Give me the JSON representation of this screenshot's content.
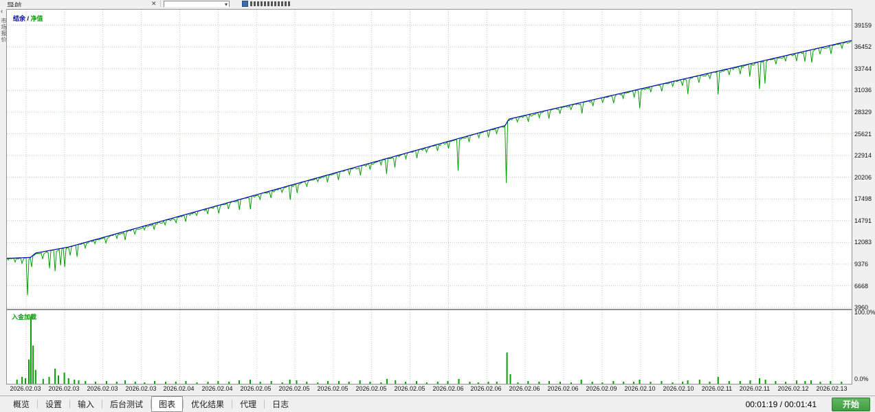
{
  "navigator": {
    "title": "导航",
    "vertical_tab": "市场报价"
  },
  "icons": {
    "close": "✕",
    "collapse": "‹",
    "combo_arrow": "▾"
  },
  "status": {
    "elapsed": "00:01:19 / 00:01:41",
    "start_label": "开始"
  },
  "tabs": {
    "items": [
      {
        "label": "概览"
      },
      {
        "label": "设置"
      },
      {
        "label": "输入"
      },
      {
        "label": "后台测试"
      },
      {
        "label": "图表",
        "active": true
      },
      {
        "label": "优化结果"
      },
      {
        "label": "代理"
      },
      {
        "label": "日志"
      }
    ]
  },
  "chart_data": [
    {
      "type": "line",
      "title": "结余 / 净值",
      "ylim": [
        3800,
        41100
      ],
      "yticks": [
        39159,
        36452,
        33744,
        31036,
        28329,
        25621,
        22914,
        20206,
        17498,
        14791,
        12083,
        9376,
        6668,
        3960
      ],
      "x_labels": [
        "2026.02.03",
        "2026.02.03",
        "2026.02.03",
        "2026.02.03",
        "2026.02.04",
        "2026.02.04",
        "2026.02.05",
        "2026.02.05",
        "2026.02.05",
        "2026.02.05",
        "2026.02.05",
        "2026.02.06",
        "2026.02.06",
        "2026.02.06",
        "2026.02.06",
        "2026.02.09",
        "2026.02.10",
        "2026.02.10",
        "2026.02.11",
        "2026.02.11",
        "2026.02.12",
        "2026.02.13"
      ],
      "series": [
        {
          "name": "结余",
          "color": "#0000B4",
          "role": "balance"
        },
        {
          "name": "净值",
          "color": "#00A000",
          "role": "equity"
        }
      ],
      "balance_anchors": [
        [
          0,
          10100
        ],
        [
          0.028,
          10200
        ],
        [
          0.034,
          10750
        ],
        [
          0.073,
          11500
        ],
        [
          0.59,
          26650
        ],
        [
          0.594,
          27450
        ],
        [
          1,
          37250
        ]
      ],
      "equity_dips": [
        [
          0.01,
          500
        ],
        [
          0.018,
          700
        ],
        [
          0.024,
          4700
        ],
        [
          0.03,
          1300
        ],
        [
          0.043,
          900
        ],
        [
          0.05,
          2200
        ],
        [
          0.057,
          2700
        ],
        [
          0.064,
          2100
        ],
        [
          0.068,
          2400
        ],
        [
          0.075,
          1100
        ],
        [
          0.083,
          1500
        ],
        [
          0.093,
          700
        ],
        [
          0.105,
          500
        ],
        [
          0.118,
          800
        ],
        [
          0.13,
          600
        ],
        [
          0.14,
          1100
        ],
        [
          0.152,
          700
        ],
        [
          0.163,
          500
        ],
        [
          0.175,
          800
        ],
        [
          0.188,
          600
        ],
        [
          0.2,
          700
        ],
        [
          0.212,
          900
        ],
        [
          0.225,
          500
        ],
        [
          0.238,
          700
        ],
        [
          0.25,
          1000
        ],
        [
          0.263,
          800
        ],
        [
          0.275,
          1300
        ],
        [
          0.288,
          1600
        ],
        [
          0.3,
          700
        ],
        [
          0.313,
          900
        ],
        [
          0.326,
          600
        ],
        [
          0.335,
          1800
        ],
        [
          0.343,
          1200
        ],
        [
          0.355,
          700
        ],
        [
          0.368,
          500
        ],
        [
          0.38,
          900
        ],
        [
          0.393,
          1000
        ],
        [
          0.405,
          700
        ],
        [
          0.418,
          1200
        ],
        [
          0.43,
          800
        ],
        [
          0.443,
          600
        ],
        [
          0.45,
          1900
        ],
        [
          0.46,
          1400
        ],
        [
          0.472,
          700
        ],
        [
          0.485,
          1000
        ],
        [
          0.497,
          600
        ],
        [
          0.51,
          800
        ],
        [
          0.522,
          900
        ],
        [
          0.535,
          4000
        ],
        [
          0.548,
          800
        ],
        [
          0.558,
          600
        ],
        [
          0.57,
          900
        ],
        [
          0.58,
          700
        ],
        [
          0.592,
          7400
        ],
        [
          0.605,
          600
        ],
        [
          0.617,
          900
        ],
        [
          0.63,
          700
        ],
        [
          0.642,
          1100
        ],
        [
          0.655,
          800
        ],
        [
          0.668,
          600
        ],
        [
          0.68,
          1400
        ],
        [
          0.693,
          800
        ],
        [
          0.705,
          600
        ],
        [
          0.718,
          1000
        ],
        [
          0.73,
          700
        ],
        [
          0.742,
          900
        ],
        [
          0.749,
          2400
        ],
        [
          0.762,
          700
        ],
        [
          0.775,
          900
        ],
        [
          0.788,
          600
        ],
        [
          0.8,
          800
        ],
        [
          0.806,
          2000
        ],
        [
          0.82,
          900
        ],
        [
          0.832,
          700
        ],
        [
          0.842,
          2900
        ],
        [
          0.855,
          800
        ],
        [
          0.868,
          1000
        ],
        [
          0.88,
          1600
        ],
        [
          0.891,
          3400
        ],
        [
          0.898,
          2900
        ],
        [
          0.91,
          800
        ],
        [
          0.922,
          700
        ],
        [
          0.935,
          1000
        ],
        [
          0.945,
          1300
        ],
        [
          0.952,
          1600
        ],
        [
          0.963,
          800
        ],
        [
          0.975,
          1100
        ],
        [
          0.988,
          700
        ]
      ]
    },
    {
      "type": "bar",
      "title": "入金加载",
      "ylim": [
        0,
        100
      ],
      "ytick_labels": [
        "100.0%",
        "0.0%"
      ],
      "color": "#00A000",
      "bars": [
        [
          0.012,
          6
        ],
        [
          0.018,
          10
        ],
        [
          0.022,
          8
        ],
        [
          0.026,
          35
        ],
        [
          0.0285,
          97
        ],
        [
          0.031,
          55
        ],
        [
          0.034,
          20
        ],
        [
          0.043,
          7
        ],
        [
          0.05,
          10
        ],
        [
          0.057,
          22
        ],
        [
          0.061,
          12
        ],
        [
          0.068,
          16
        ],
        [
          0.073,
          8
        ],
        [
          0.08,
          6
        ],
        [
          0.085,
          5
        ],
        [
          0.093,
          4
        ],
        [
          0.105,
          3
        ],
        [
          0.118,
          4
        ],
        [
          0.13,
          3
        ],
        [
          0.14,
          5
        ],
        [
          0.152,
          3
        ],
        [
          0.163,
          2
        ],
        [
          0.175,
          4
        ],
        [
          0.188,
          3
        ],
        [
          0.2,
          3
        ],
        [
          0.212,
          4
        ],
        [
          0.225,
          2
        ],
        [
          0.238,
          3
        ],
        [
          0.25,
          4
        ],
        [
          0.263,
          3
        ],
        [
          0.275,
          5
        ],
        [
          0.288,
          6
        ],
        [
          0.3,
          3
        ],
        [
          0.313,
          4
        ],
        [
          0.326,
          2
        ],
        [
          0.335,
          6
        ],
        [
          0.343,
          5
        ],
        [
          0.355,
          3
        ],
        [
          0.368,
          2
        ],
        [
          0.38,
          4
        ],
        [
          0.393,
          4
        ],
        [
          0.405,
          3
        ],
        [
          0.418,
          5
        ],
        [
          0.43,
          3
        ],
        [
          0.443,
          2
        ],
        [
          0.45,
          7
        ],
        [
          0.46,
          5
        ],
        [
          0.472,
          3
        ],
        [
          0.485,
          4
        ],
        [
          0.497,
          2
        ],
        [
          0.51,
          3
        ],
        [
          0.522,
          4
        ],
        [
          0.535,
          7
        ],
        [
          0.548,
          3
        ],
        [
          0.558,
          2
        ],
        [
          0.57,
          3
        ],
        [
          0.58,
          3
        ],
        [
          0.592,
          45
        ],
        [
          0.596,
          14
        ],
        [
          0.605,
          2
        ],
        [
          0.617,
          4
        ],
        [
          0.63,
          3
        ],
        [
          0.642,
          4
        ],
        [
          0.655,
          3
        ],
        [
          0.668,
          2
        ],
        [
          0.68,
          6
        ],
        [
          0.693,
          3
        ],
        [
          0.705,
          2
        ],
        [
          0.718,
          4
        ],
        [
          0.73,
          3
        ],
        [
          0.742,
          3
        ],
        [
          0.749,
          6
        ],
        [
          0.762,
          3
        ],
        [
          0.775,
          4
        ],
        [
          0.788,
          2
        ],
        [
          0.8,
          3
        ],
        [
          0.806,
          5
        ],
        [
          0.82,
          6
        ],
        [
          0.832,
          3
        ],
        [
          0.842,
          10
        ],
        [
          0.855,
          4
        ],
        [
          0.868,
          4
        ],
        [
          0.88,
          5
        ],
        [
          0.891,
          8
        ],
        [
          0.898,
          6
        ],
        [
          0.91,
          4
        ],
        [
          0.922,
          3
        ],
        [
          0.935,
          5
        ],
        [
          0.945,
          4
        ],
        [
          0.952,
          5
        ],
        [
          0.963,
          3
        ],
        [
          0.975,
          4
        ],
        [
          0.988,
          3
        ]
      ]
    }
  ]
}
